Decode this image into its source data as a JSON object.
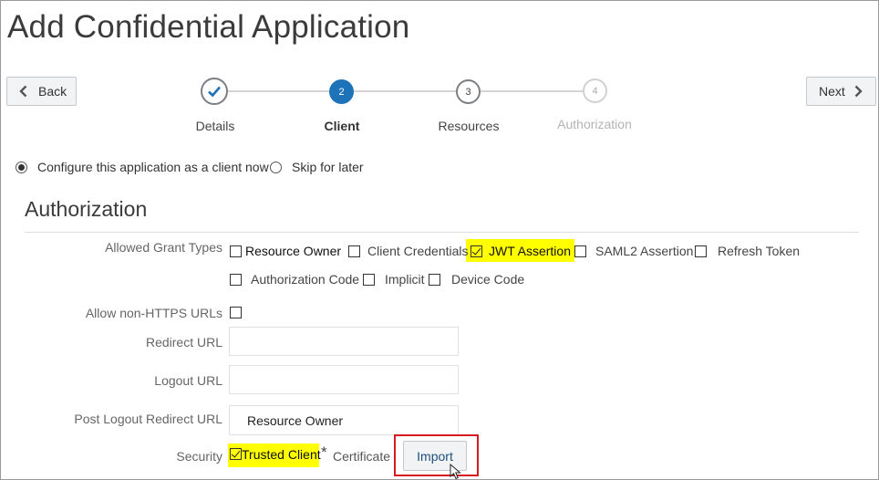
{
  "page": {
    "title": "Add Confidential Application"
  },
  "nav": {
    "back_label": "Back",
    "next_label": "Next"
  },
  "train": {
    "steps": [
      {
        "label": "Details",
        "number": "1",
        "state": "completed"
      },
      {
        "label": "Client",
        "number": "2",
        "state": "current"
      },
      {
        "label": "Resources",
        "number": "3",
        "state": "upcoming"
      },
      {
        "label": "Authorization",
        "number": "4",
        "state": "disabled"
      }
    ]
  },
  "client_config": {
    "options": [
      {
        "label": "Configure this application as a client now",
        "selected": true
      },
      {
        "label": "Skip for later",
        "selected": false
      }
    ]
  },
  "authorization": {
    "title": "Authorization",
    "allowed_grant_types_label": "Allowed Grant Types",
    "grant_types": [
      {
        "label": "Resource Owner",
        "checked": false
      },
      {
        "label": "Client Credentials",
        "checked": false
      },
      {
        "label": "JWT Assertion",
        "checked": true
      },
      {
        "label": "SAML2 Assertion",
        "checked": false
      },
      {
        "label": "Refresh Token",
        "checked": false
      },
      {
        "label": "Authorization Code",
        "checked": false
      },
      {
        "label": "Implicit",
        "checked": false
      },
      {
        "label": "Device Code",
        "checked": false
      }
    ],
    "allow_non_https_label": "Allow non-HTTPS URLs",
    "allow_non_https_checked": false,
    "redirect_url_label": "Redirect URL",
    "redirect_url_value": "",
    "logout_url_label": "Logout URL",
    "logout_url_value": "",
    "post_logout_label": "Post Logout Redirect URL",
    "post_logout_value": "Resource Owner",
    "security_label": "Security",
    "trusted_client_label": "Trusted Client",
    "trusted_client_checked": true,
    "required_marker": "*",
    "certificate_label": "Certificate",
    "import_label": "Import"
  },
  "colors": {
    "accent": "#1d72b8",
    "highlight": "#ffff00",
    "callout_border": "#d71920"
  },
  "icons": [
    "chevron-left-icon",
    "chevron-right-icon",
    "checkmark-icon",
    "mouse-pointer-icon"
  ]
}
